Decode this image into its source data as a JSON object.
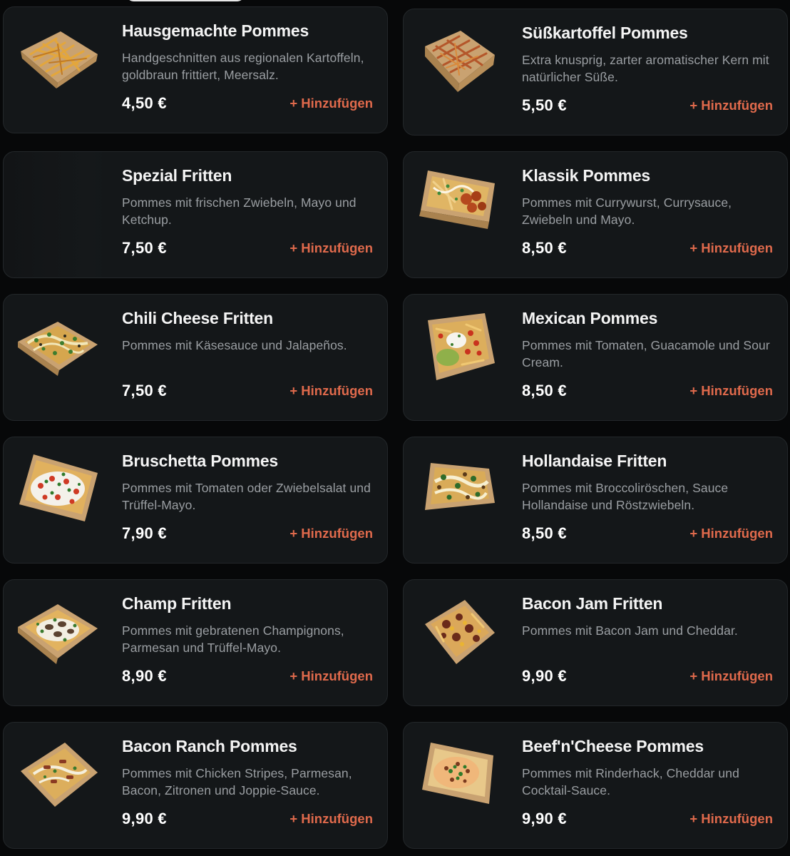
{
  "add_label": "+ Hinzufügen",
  "colors": {
    "background": "#070809",
    "card": "#141719",
    "accent": "#e06a4c",
    "title": "#f4f4f4",
    "description": "#9a9ea2"
  },
  "products": [
    {
      "title": "Hausgemachte Pommes",
      "description": "Handgeschnitten aus regionalen Kartoffeln, goldbraun frittiert, Meersalz.",
      "price": "4,50 €",
      "image": "fries-box-image"
    },
    {
      "title": "Süßkartoffel Pommes",
      "description": "Extra knusprig, zarter aromatischer Kern mit natürlicher Süße.",
      "price": "5,50 €",
      "image": "sweet-potato-fries-image"
    },
    {
      "title": "Spezial Fritten",
      "description": "Pommes mit frischen Zwiebeln, Mayo und Ketchup.",
      "price": "7,50 €",
      "image": "no-image"
    },
    {
      "title": "Klassik Pommes",
      "description": "Pommes mit Currywurst, Currysauce, Zwiebeln und Mayo.",
      "price": "8,50 €",
      "image": "currywurst-fries-image"
    },
    {
      "title": "Chili Cheese Fritten",
      "description": "Pommes mit Käsesauce und Jalapeños.",
      "price": "7,50 €",
      "image": "chili-cheese-fries-image"
    },
    {
      "title": "Mexican Pommes",
      "description": "Pommes mit Tomaten, Guacamole und Sour Cream.",
      "price": "8,50 €",
      "image": "mexican-fries-image"
    },
    {
      "title": "Bruschetta Pommes",
      "description": "Pommes mit Tomaten oder Zwiebelsalat und Trüffel-Mayo.",
      "price": "7,90 €",
      "image": "bruschetta-fries-image"
    },
    {
      "title": "Hollandaise Fritten",
      "description": "Pommes mit Broccoliröschen, Sauce Hollandaise und Röstzwiebeln.",
      "price": "8,50 €",
      "image": "hollandaise-fries-image"
    },
    {
      "title": "Champ Fritten",
      "description": "Pommes mit gebratenen Champignons, Parmesan und Trüffel-Mayo.",
      "price": "8,90 €",
      "image": "mushroom-fries-image"
    },
    {
      "title": "Bacon Jam Fritten",
      "description": "Pommes mit Bacon Jam und Cheddar.",
      "price": "9,90 €",
      "image": "bacon-jam-fries-image"
    },
    {
      "title": "Bacon Ranch Pommes",
      "description": "Pommes mit Chicken Stripes, Parmesan, Bacon, Zitronen und Joppie-Sauce.",
      "price": "9,90 €",
      "image": "bacon-ranch-fries-image"
    },
    {
      "title": "Beef'n'Cheese Pommes",
      "description": "Pommes mit Rinderhack, Cheddar und Cocktail-Sauce.",
      "price": "9,90 €",
      "image": "beef-cheese-fries-image"
    }
  ]
}
